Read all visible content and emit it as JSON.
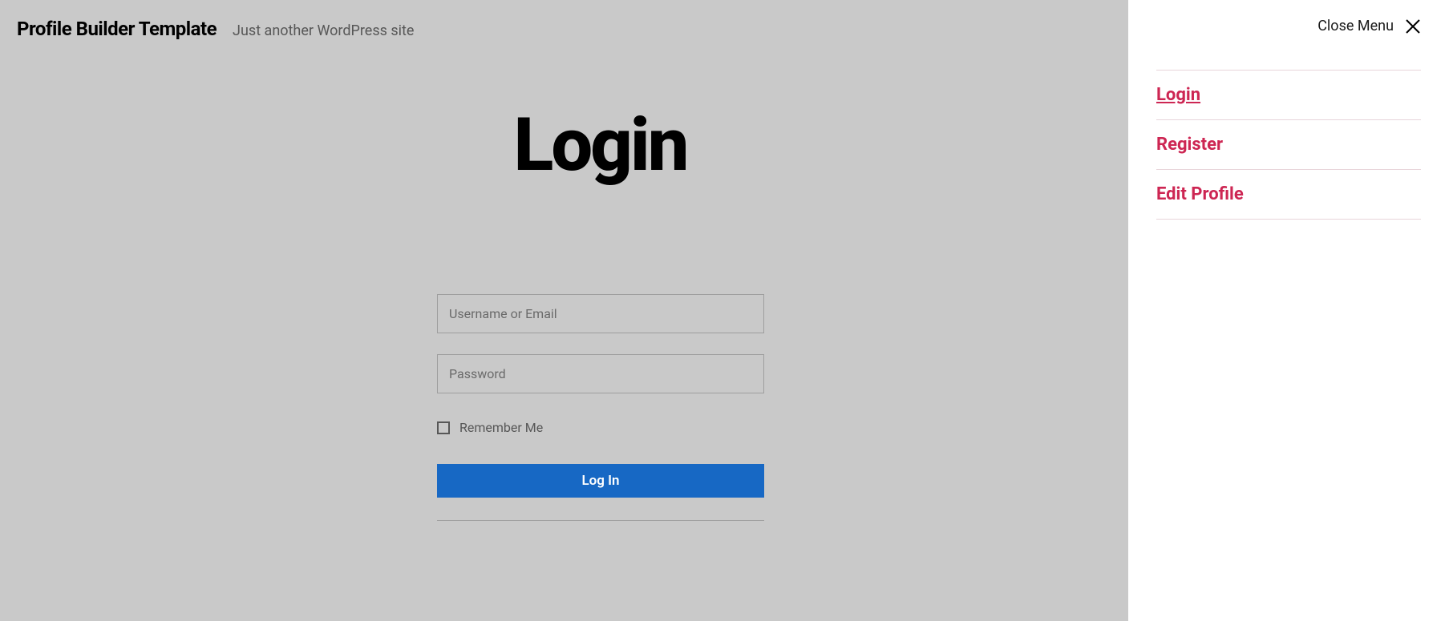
{
  "header": {
    "site_title": "Profile Builder Template",
    "tagline": "Just another WordPress site"
  },
  "page": {
    "heading": "Login"
  },
  "form": {
    "username_placeholder": "Username or Email",
    "password_placeholder": "Password",
    "remember_label": "Remember Me",
    "submit_label": "Log In"
  },
  "menu": {
    "close_label": "Close Menu",
    "items": [
      {
        "label": "Login",
        "active": true
      },
      {
        "label": "Register",
        "active": false
      },
      {
        "label": "Edit Profile",
        "active": false
      }
    ]
  }
}
